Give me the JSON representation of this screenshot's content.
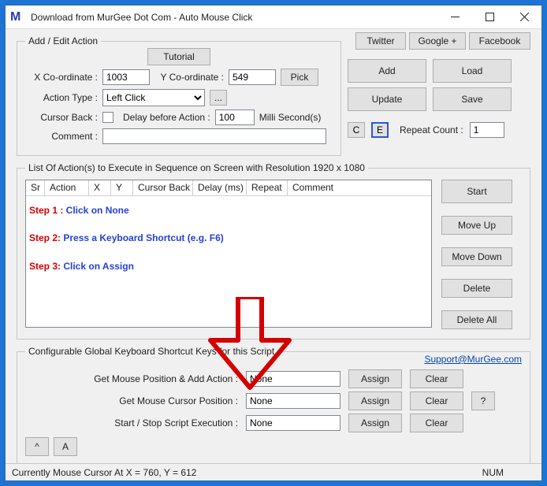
{
  "titlebar": {
    "logo": "M",
    "title": "Download from MurGee Dot Com - Auto Mouse Click"
  },
  "top_buttons": {
    "tutorial": "Tutorial",
    "twitter": "Twitter",
    "googleplus": "Google +",
    "facebook": "Facebook"
  },
  "add_edit": {
    "legend": "Add / Edit Action",
    "xcoord_label": "X Co-ordinate :",
    "xcoord_value": "1003",
    "ycoord_label": "Y Co-ordinate :",
    "ycoord_value": "549",
    "pick_label": "Pick",
    "actiontype_label": "Action Type :",
    "actiontype_value": "Left Click",
    "ellipsis": "...",
    "cursorback_label": "Cursor Back :",
    "delay_label": "Delay before Action :",
    "delay_value": "100",
    "delay_unit": "Milli Second(s)",
    "comment_label": "Comment :",
    "comment_value": "",
    "c_btn": "C",
    "e_btn": "E",
    "repeat_label": "Repeat Count :",
    "repeat_value": "1"
  },
  "side_top": {
    "add": "Add",
    "load": "Load",
    "update": "Update",
    "save": "Save"
  },
  "list": {
    "legend": "List Of Action(s) to Execute in Sequence on Screen with Resolution 1920 x 1080",
    "cols": {
      "sr": "Sr",
      "action": "Action",
      "x": "X",
      "y": "Y",
      "cursorback": "Cursor Back",
      "delay": "Delay (ms)",
      "repeat": "Repeat",
      "comment": "Comment"
    }
  },
  "side_list": {
    "start": "Start",
    "moveup": "Move Up",
    "movedown": "Move Down",
    "delete": "Delete",
    "deleteall": "Delete All"
  },
  "steps": {
    "s1_label": "Step 1 :",
    "s1_text": " Click on None",
    "s2_label": "Step 2:",
    "s2_text": " Press a Keyboard Shortcut (e.g. F6)",
    "s3_label": "Step 3:",
    "s3_text": " Click on Assign"
  },
  "shortcuts": {
    "legend": "Configurable Global Keyboard Shortcut Keys for this Script",
    "support": "Support@MurGee.com",
    "assign": "Assign",
    "clear": "Clear",
    "help": "?",
    "row1_label": "Get Mouse Position & Add Action :",
    "row1_value": "None",
    "row2_label": "Get Mouse Cursor Position :",
    "row2_value": "None",
    "row3_label": "Start / Stop Script Execution :",
    "row3_value": "None"
  },
  "bottom": {
    "caret": "^",
    "a": "A"
  },
  "status": {
    "text": "Currently Mouse Cursor At X = 760, Y = 612",
    "num": "NUM"
  }
}
